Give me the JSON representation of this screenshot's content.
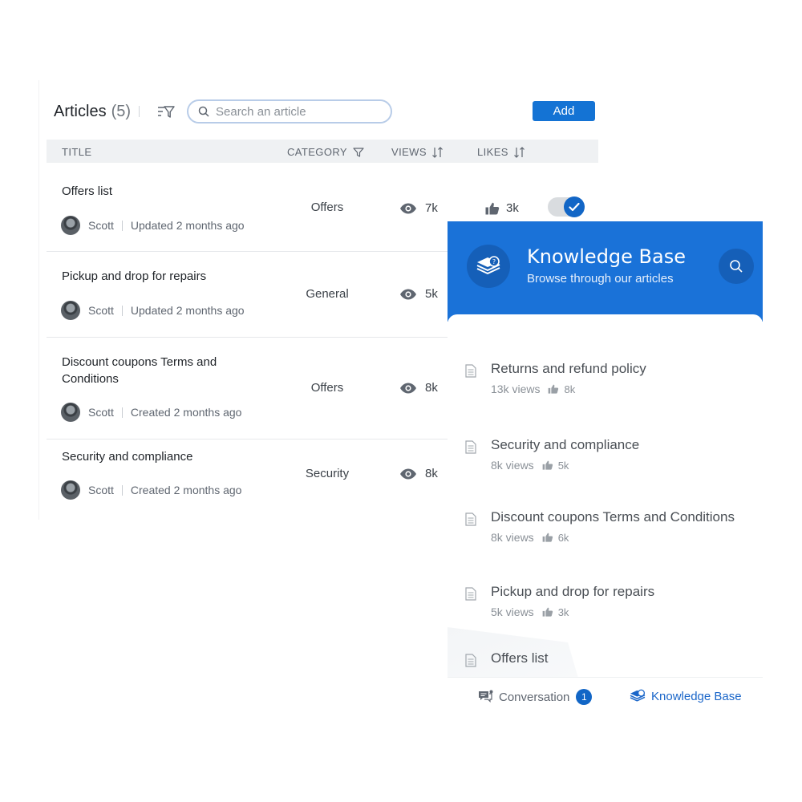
{
  "articles": {
    "title": "Articles",
    "count": "(5)",
    "search_placeholder": "Search an article",
    "add_label": "Add",
    "columns": {
      "title": "TITLE",
      "category": "CATEGORY",
      "views": "VIEWS",
      "likes": "LIKES"
    },
    "rows": [
      {
        "title": "Offers list",
        "author": "Scott",
        "updated": "Updated 2 months ago",
        "category": "Offers",
        "views": "7k",
        "likes": "3k"
      },
      {
        "title": "Pickup and drop for repairs",
        "author": "Scott",
        "updated": "Updated 2 months ago",
        "category": "General",
        "views": "5k"
      },
      {
        "title": "Discount coupons Terms and Conditions",
        "author": "Scott",
        "updated": "Created 2 months ago",
        "category": "Offers",
        "views": "8k"
      },
      {
        "title": "Security and compliance",
        "author": "Scott",
        "updated": "Created 2 months ago",
        "category": "Security",
        "views": "8k"
      }
    ],
    "toggle_on": true
  },
  "knowledge_base": {
    "title": "Knowledge Base",
    "subtitle": "Browse through our articles",
    "items": [
      {
        "title": "Returns and refund policy",
        "views": "13k views",
        "likes": "8k"
      },
      {
        "title": "Security and compliance",
        "views": "8k views",
        "likes": "5k"
      },
      {
        "title": "Discount coupons Terms and Conditions",
        "views": "8k views",
        "likes": "6k"
      },
      {
        "title": "Pickup and drop for repairs",
        "views": "5k views",
        "likes": "3k"
      },
      {
        "title": "Offers list"
      }
    ],
    "footer": {
      "conversation_label": "Conversation",
      "conversation_badge": "1",
      "kb_label": "Knowledge Base"
    }
  },
  "colors": {
    "primary": "#1a72d8",
    "button": "#1473d4",
    "header_bg": "#eff1f3"
  },
  "icons": [
    "filter-icon",
    "search-icon",
    "sort-icon",
    "eye-icon",
    "thumbs-up-icon",
    "check-icon",
    "knowledge-base-icon",
    "document-icon",
    "conversation-icon"
  ]
}
